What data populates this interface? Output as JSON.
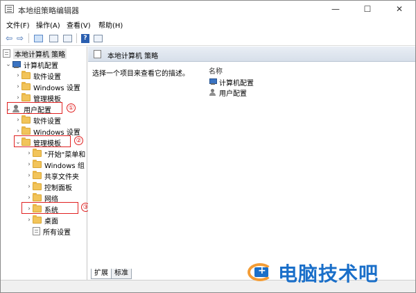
{
  "window": {
    "title": "本地组策略编辑器"
  },
  "window_controls": {
    "minimize": "—",
    "maximize": "☐",
    "close": "✕"
  },
  "menu": [
    "文件(F)",
    "操作(A)",
    "查看(V)",
    "帮助(H)"
  ],
  "toolbar": {
    "back": "⇦",
    "forward": "⇨",
    "help": "?"
  },
  "tree": {
    "root": "本地计算机 策略",
    "computer_config": "计算机配置",
    "computer_children": [
      "软件设置",
      "Windows 设置",
      "管理模板"
    ],
    "user_config": "用户配置",
    "user_children": [
      "软件设置",
      "Windows 设置",
      "管理模板"
    ],
    "admin_template_children": [
      "\"开始\"菜单和",
      "Windows 组",
      "共享文件夹",
      "控制面板",
      "网络",
      "系统",
      "桌面",
      "所有设置"
    ]
  },
  "annotations": [
    "①",
    "②",
    "③"
  ],
  "content": {
    "header": "本地计算机 策略",
    "description": "选择一个项目来查看它的描述。",
    "column_name": "名称",
    "items": [
      "计算机配置",
      "用户配置"
    ]
  },
  "tabs": [
    "扩展",
    "标准"
  ],
  "watermark": {
    "text": "电脑技术吧"
  }
}
